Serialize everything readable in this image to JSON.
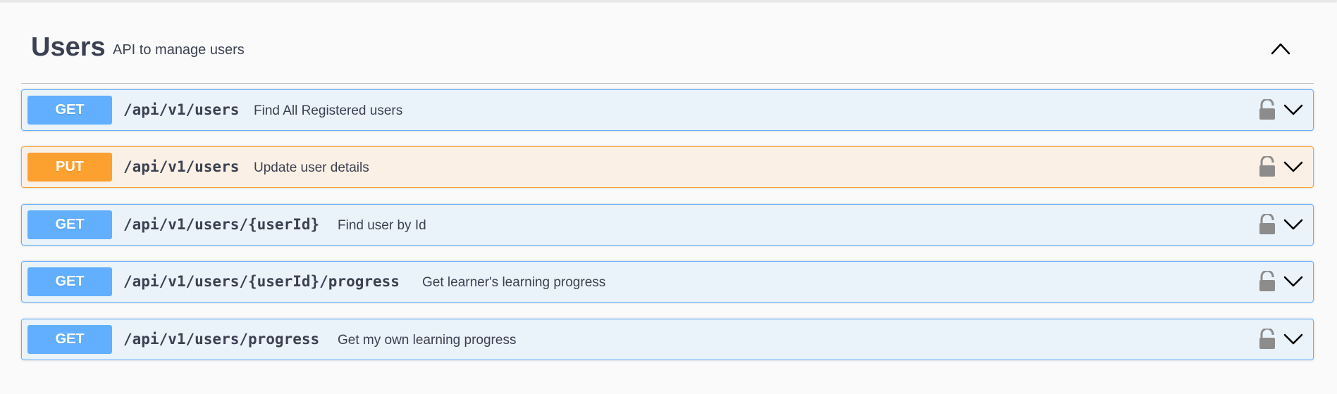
{
  "section": {
    "name": "Users",
    "description": "API to manage users",
    "collapse_icon": "chevron-up-icon"
  },
  "operations": [
    {
      "method": "GET",
      "path": "/api/v1/users",
      "summary": "Find All Registered users",
      "color": "#61affe"
    },
    {
      "method": "PUT",
      "path": "/api/v1/users",
      "summary": "Update user details",
      "color": "#fca130"
    },
    {
      "method": "GET",
      "path": "/api/v1/users/{userId}",
      "summary": "Find user by Id",
      "color": "#61affe"
    },
    {
      "method": "GET",
      "path": "/api/v1/users/{userId}/progress",
      "summary": "Get learner's learning progress",
      "color": "#61affe"
    },
    {
      "method": "GET",
      "path": "/api/v1/users/progress",
      "summary": "Get my own learning progress",
      "color": "#61affe"
    }
  ],
  "icons": {
    "lock": "lock-icon",
    "expand": "chevron-down-icon"
  }
}
